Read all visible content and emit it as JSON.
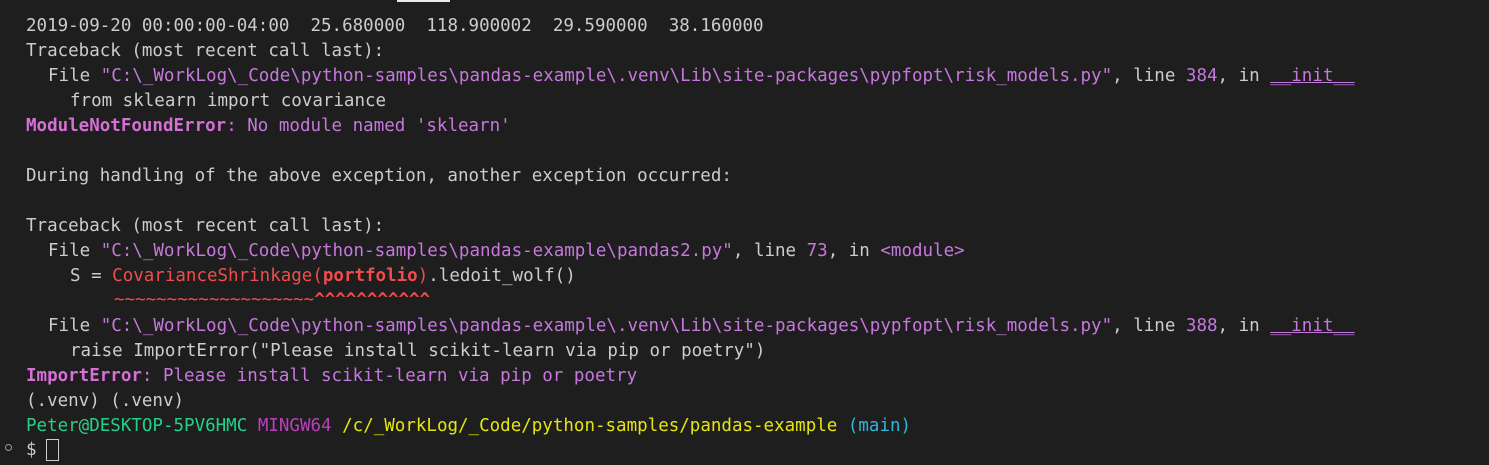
{
  "terminal": {
    "lines": {
      "data_row": {
        "date": "2019-09-20 00:00:00-04:00",
        "v1": "25.680000",
        "v2": "118.900002",
        "v3": "29.590000",
        "v4": "38.160000"
      },
      "tb1_header": "Traceback (most recent call last):",
      "tb1_file": {
        "prefix": "File ",
        "path": "\"C:\\_WorkLog\\_Code\\python-samples\\pandas-example\\.venv\\Lib\\site-packages\\pypfopt\\risk_models.py\"",
        "sep1": ", line ",
        "line_no": "384",
        "sep2": ", in ",
        "func": "__init__"
      },
      "tb1_code": "from sklearn import covariance",
      "err1": {
        "name": "ModuleNotFoundError",
        "colon": ": ",
        "message": "No module named 'sklearn'"
      },
      "during_handling": "During handling of the above exception, another exception occurred:",
      "tb2_header": "Traceback (most recent call last):",
      "tb2_file1": {
        "prefix": "File ",
        "path": "\"C:\\_WorkLog\\_Code\\python-samples\\pandas-example\\pandas2.py\"",
        "sep1": ", line ",
        "line_no": "73",
        "sep2": ", in ",
        "func": "<module>"
      },
      "tb2_code1": {
        "prefix": "S = ",
        "call": "CovarianceShrinkage(",
        "arg": "portfolio",
        "close": ")",
        "suffix": ".ledoit_wolf()"
      },
      "tb2_markers": {
        "tildes": "~~~~~~~~~~~~~~~~~~~",
        "carets": "^^^^^^^^^^^"
      },
      "tb2_file2": {
        "prefix": "File ",
        "path": "\"C:\\_WorkLog\\_Code\\python-samples\\pandas-example\\.venv\\Lib\\site-packages\\pypfopt\\risk_models.py\"",
        "sep1": ", line ",
        "line_no": "388",
        "sep2": ", in ",
        "func": "__init__"
      },
      "tb2_code2": "raise ImportError(\"Please install scikit-learn via pip or poetry\")",
      "err2": {
        "name": "ImportError",
        "colon": ": ",
        "message": "Please install scikit-learn via pip or poetry"
      },
      "venv_line": "(.venv) (.venv)",
      "prompt": {
        "user_host": "Peter@DESKTOP-5PV6HMC",
        "msys": "MINGW64",
        "cwd": "/c/_WorkLog/_Code/python-samples/pandas-example",
        "branch": "(main)"
      },
      "input_prompt": "$"
    }
  },
  "colors": {
    "background": "#1e1e1e",
    "foreground": "#cccccc",
    "magenta": "#c678dd",
    "red": "#f14c4c",
    "green": "#23d18b",
    "purple": "#bc3fbc",
    "yellow": "#e5e510",
    "cyan": "#29b8db"
  }
}
